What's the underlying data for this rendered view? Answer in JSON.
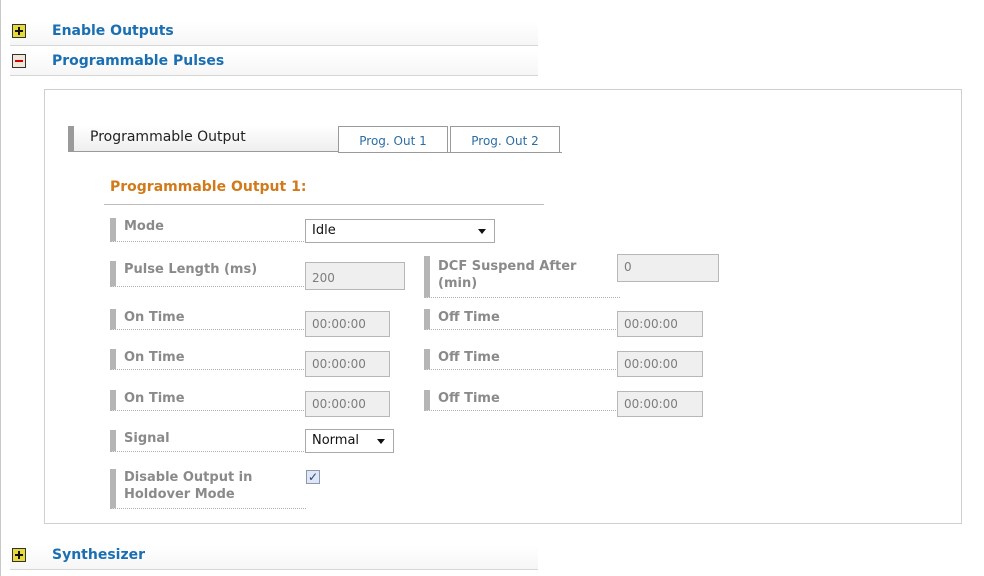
{
  "accordion": {
    "enable_outputs": {
      "label": "Enable Outputs",
      "state": "collapsed",
      "icon": "plus-icon"
    },
    "programmable_pulses": {
      "label": "Programmable Pulses",
      "state": "expanded",
      "icon": "minus-icon"
    },
    "synthesizer": {
      "label": "Synthesizer",
      "state": "collapsed",
      "icon": "plus-icon"
    }
  },
  "tabs": {
    "group_label": "Programmable Output",
    "items": [
      {
        "label": "Prog. Out 1"
      },
      {
        "label": "Prog. Out 2"
      }
    ]
  },
  "form": {
    "title": "Programmable Output 1:",
    "mode": {
      "label": "Mode",
      "value": "Idle"
    },
    "pulse_length": {
      "label": "Pulse Length (ms)",
      "value": "200"
    },
    "dcf_suspend": {
      "label": "DCF Suspend After (min)",
      "value": "0"
    },
    "times": [
      {
        "on_label": "On Time",
        "on_value": "00:00:00",
        "off_label": "Off Time",
        "off_value": "00:00:00"
      },
      {
        "on_label": "On Time",
        "on_value": "00:00:00",
        "off_label": "Off Time",
        "off_value": "00:00:00"
      },
      {
        "on_label": "On Time",
        "on_value": "00:00:00",
        "off_label": "Off Time",
        "off_value": "00:00:00"
      }
    ],
    "signal": {
      "label": "Signal",
      "value": "Normal"
    },
    "disable_output": {
      "label": "Disable Output in Holdover Mode",
      "checked": true,
      "check_glyph": "✓"
    }
  },
  "colors": {
    "accordion_title": "#1a6fb3",
    "section_title": "#d27a1a",
    "tab_text": "#2c6ea5",
    "label_text": "#8a8a8a",
    "plus_icon_fill": "#e8d93a",
    "minus_icon_bar": "#d00000"
  }
}
